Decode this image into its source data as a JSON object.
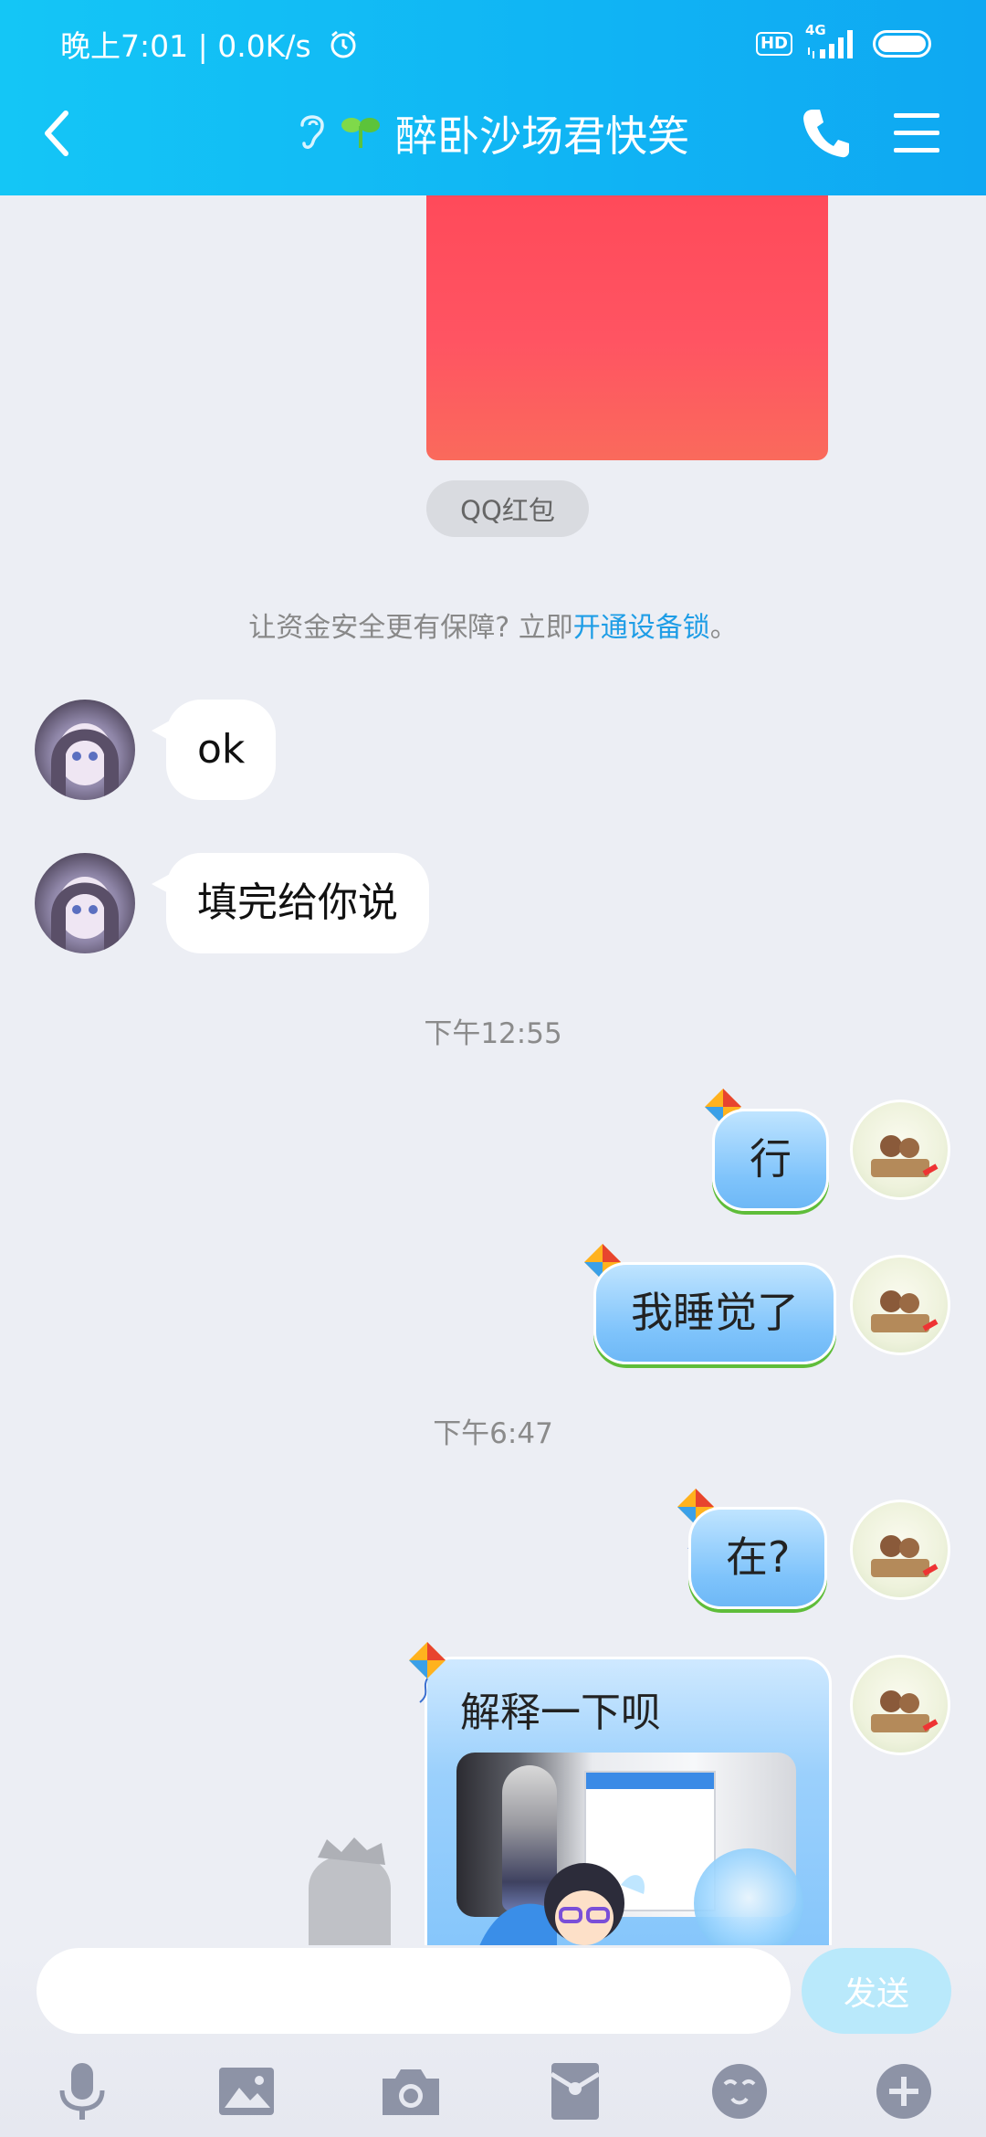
{
  "status_bar": {
    "time": "晚上7:01 | 0.0K/s",
    "hd": "HD",
    "network": "4G"
  },
  "header": {
    "title": "醉卧沙场君快笑"
  },
  "chat": {
    "red_packet_label": "QQ红包",
    "security_notice": {
      "text": "让资金安全更有保障? 立即",
      "link": "开通设备锁",
      "suffix": "。"
    },
    "messages": [
      {
        "side": "left",
        "text": "ok"
      },
      {
        "side": "left",
        "text": "填完给你说"
      },
      {
        "type": "time",
        "text": "下午12:55"
      },
      {
        "side": "right",
        "text": "行"
      },
      {
        "side": "right",
        "text": "我睡觉了"
      },
      {
        "type": "time",
        "text": "下午6:47"
      },
      {
        "side": "right",
        "text": "在?"
      },
      {
        "side": "right",
        "text": "解释一下呗",
        "has_image": true
      }
    ]
  },
  "input": {
    "value": "",
    "placeholder": "",
    "send_label": "发送"
  },
  "toolbar": {
    "icons": [
      "microphone-icon",
      "image-icon",
      "camera-icon",
      "red-packet-icon",
      "emoji-icon",
      "plus-icon"
    ]
  },
  "colors": {
    "header_start": "#14c6f6",
    "header_end": "#0fa8f2",
    "link": "#1e9de6",
    "red_packet": "#ff4a5a",
    "send_button": "#b9e9fb"
  }
}
